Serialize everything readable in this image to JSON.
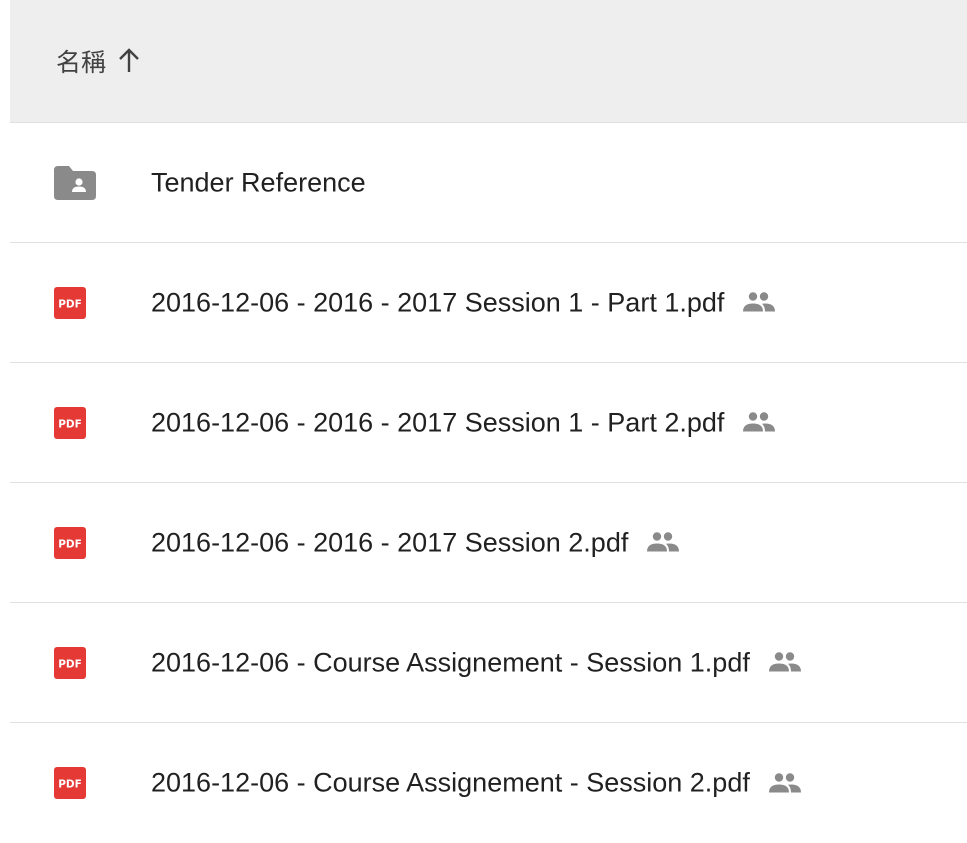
{
  "header": {
    "sort_column_label": "名稱",
    "sort_direction_icon": "arrow-up-icon"
  },
  "files": [
    {
      "type": "shared-folder",
      "icon": "shared-folder-icon",
      "name": "Tender Reference",
      "shared": false
    },
    {
      "type": "pdf",
      "icon": "pdf-icon",
      "name": "2016-12-06 - 2016 - 2017 Session 1 - Part 1.pdf",
      "shared": true
    },
    {
      "type": "pdf",
      "icon": "pdf-icon",
      "name": "2016-12-06 - 2016 - 2017 Session 1 - Part 2.pdf",
      "shared": true
    },
    {
      "type": "pdf",
      "icon": "pdf-icon",
      "name": "2016-12-06 - 2016 - 2017 Session 2.pdf",
      "shared": true
    },
    {
      "type": "pdf",
      "icon": "pdf-icon",
      "name": "2016-12-06 - Course Assignement - Session 1.pdf",
      "shared": true
    },
    {
      "type": "pdf",
      "icon": "pdf-icon",
      "name": "2016-12-06 - Course Assignement - Session 2.pdf",
      "shared": true
    }
  ],
  "colors": {
    "header_bg": "#eeeeee",
    "divider": "#e0e0e0",
    "pdf_red": "#e53935",
    "icon_gray": "#8a8a8a"
  }
}
